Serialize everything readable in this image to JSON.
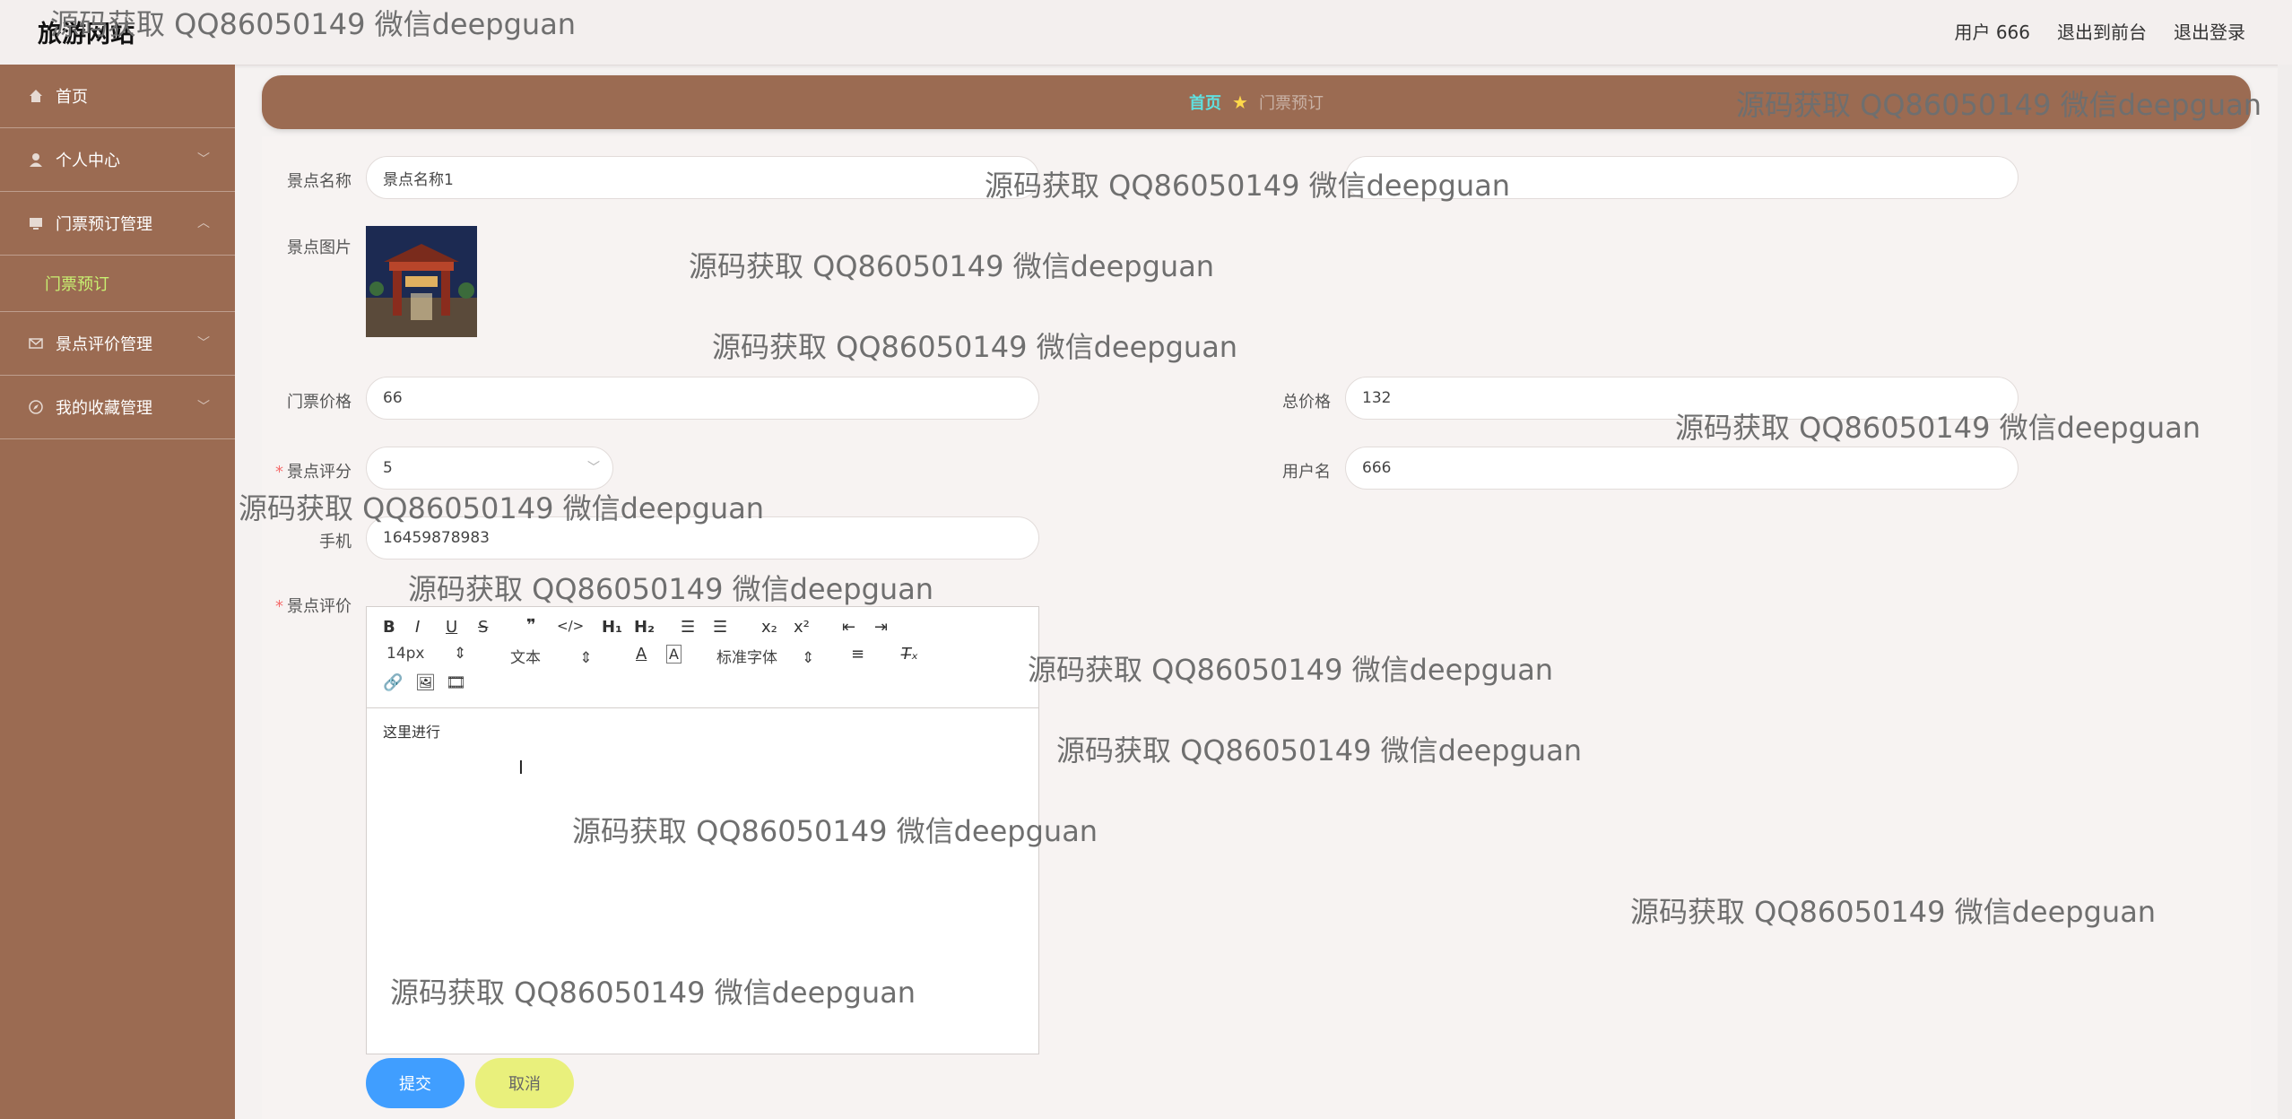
{
  "header": {
    "brand": "旅游网站",
    "user_label": "用户 666",
    "to_front_label": "退出到前台",
    "logout_label": "退出登录"
  },
  "sidebar": {
    "items": [
      {
        "label": "首页",
        "icon": "home-icon"
      },
      {
        "label": "个人中心",
        "icon": "user-icon"
      },
      {
        "label": "门票预订管理",
        "icon": "monitor-icon"
      },
      {
        "label": "景点评价管理",
        "icon": "mail-icon"
      },
      {
        "label": "我的收藏管理",
        "icon": "compass-icon"
      }
    ],
    "submenu_active": "门票预订"
  },
  "breadcrumb": {
    "home": "首页",
    "current": "门票预订"
  },
  "form": {
    "spot_name_label": "景点名称",
    "spot_name_value": "景点名称1",
    "spot_image_label": "景点图片",
    "ticket_price_label": "门票价格",
    "ticket_price_value": "66",
    "total_price_label": "总价格",
    "total_price_value": "132",
    "rating_label": "景点评分",
    "rating_value": "5",
    "username_label": "用户名",
    "username_value": "666",
    "phone_label": "手机",
    "phone_value": "16459878983",
    "review_label": "景点评价",
    "editor_font_size": "14px",
    "editor_text_type": "文本",
    "editor_font_family": "标准字体",
    "editor_content": "这里进行"
  },
  "buttons": {
    "submit": "提交",
    "cancel": "取消"
  },
  "watermark": "源码获取 QQ86050149 微信deepguan",
  "colors": {
    "sidebar_bg": "#9b6b52",
    "accent_green": "#c8f071",
    "breadcrumb_home": "#5fe0e0",
    "submit_blue": "#409eff",
    "cancel_yellow": "#e9f07c"
  }
}
